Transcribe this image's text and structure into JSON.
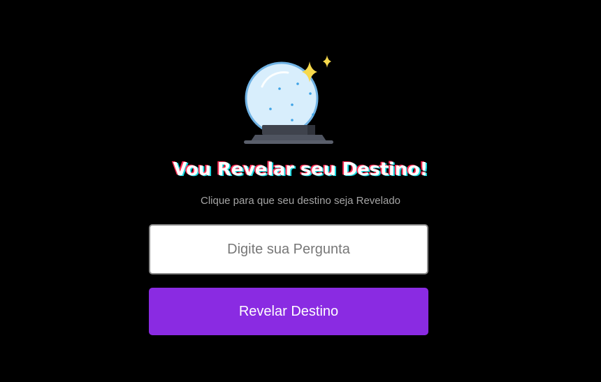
{
  "hero": {
    "icon": "crystal-ball-icon"
  },
  "heading": {
    "title": "Vou Revelar seu Destino!",
    "subtitle": "Clique para que seu destino seja Revelado"
  },
  "form": {
    "question_placeholder": "Digite sua Pergunta",
    "question_value": "",
    "submit_label": "Revelar Destino"
  },
  "colors": {
    "background": "#000000",
    "accent": "#8a2be2",
    "title_shadow_red": "#ff2d55",
    "title_shadow_cyan": "#1ad7e0",
    "sparkle": "#f7d94c",
    "ball_fill": "#d8eefc"
  }
}
